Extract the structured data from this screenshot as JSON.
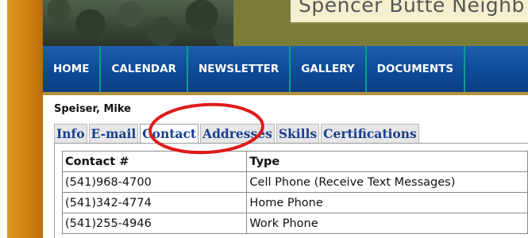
{
  "banner": {
    "site_title": "Spencer Butte Neighb"
  },
  "nav": {
    "items": [
      "HOME",
      "CALENDAR",
      "NEWSLETTER",
      "GALLERY",
      "DOCUMENTS"
    ]
  },
  "person": {
    "name": "Speiser, Mike"
  },
  "tabs": {
    "items": [
      "Info",
      "E-mail",
      "Contact",
      "Addresses",
      "Skills",
      "Certifications"
    ],
    "active": "Contact"
  },
  "contacts_table": {
    "headers": [
      "Contact #",
      "Type"
    ],
    "rows": [
      [
        "(541)968-4700",
        "Cell Phone (Receive Text Messages)"
      ],
      [
        "(541)342-4774",
        "Home Phone"
      ],
      [
        "(541)255-4946",
        "Work Phone"
      ]
    ]
  },
  "colors": {
    "nav_blue": "#0e4c9a",
    "nav_divider": "#0d9d8c",
    "tab_text": "#1a3f8f",
    "highlight_circle": "#e01b1b",
    "sidebar_gold": "#d88f18"
  }
}
